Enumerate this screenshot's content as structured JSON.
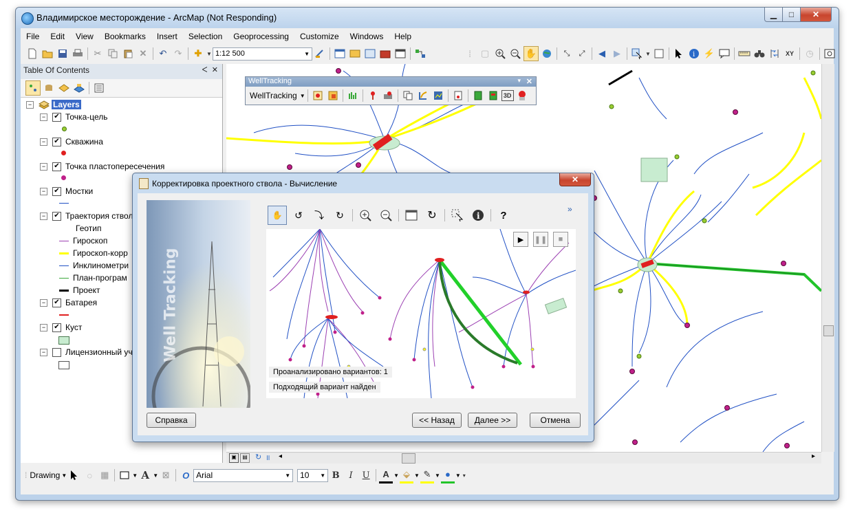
{
  "window": {
    "title": "Владимирское месторождение - ArcMap (Not Responding)"
  },
  "menu": [
    "File",
    "Edit",
    "View",
    "Bookmarks",
    "Insert",
    "Selection",
    "Geoprocessing",
    "Customize",
    "Windows",
    "Help"
  ],
  "toolbar": {
    "scale": "1:12 500"
  },
  "toc": {
    "title": "Table Of Contents",
    "root": "Layers",
    "layers": [
      {
        "label": "Точка-цель",
        "checked": true
      },
      {
        "label": "Скважина",
        "checked": true
      },
      {
        "label": "Точка пластопересечения",
        "checked": true
      },
      {
        "label": "Мостки",
        "checked": true
      },
      {
        "label": "Траектория ствол",
        "checked": true
      },
      {
        "label": "Батарея",
        "checked": true
      },
      {
        "label": "Куст",
        "checked": true
      },
      {
        "label": "Лицензионный уч",
        "checked": false
      }
    ],
    "trajectory_field": "Геотип",
    "trajectory_classes": [
      "Гироскоп",
      "Гироскоп-корр",
      "Инклинометри",
      "План-програм",
      "Проект"
    ]
  },
  "welltracking_toolbar": {
    "title": "WellTracking",
    "menu_label": "WellTracking"
  },
  "dialog": {
    "title": "Корректировка проектного ствола - Вычисление",
    "banner_text": "Well Tracking",
    "status_line1": "Проанализировано вариантов: 1",
    "status_line2": "Подходящий вариант найден",
    "help_button": "Справка",
    "back_button": "<< Назад",
    "next_button": "Далее >>",
    "cancel_button": "Отмена"
  },
  "drawing_toolbar": {
    "label": "Drawing",
    "font": "Arial",
    "font_size": "10"
  },
  "colors": {
    "gyroscope": "#9b3fb2",
    "gyroscope_corr": "#ffff00",
    "inclinometry": "#1f4fc4",
    "plan": "#3aa83a",
    "project": "#000000",
    "battery": "#e02020",
    "pad": "#c8ecd0"
  }
}
